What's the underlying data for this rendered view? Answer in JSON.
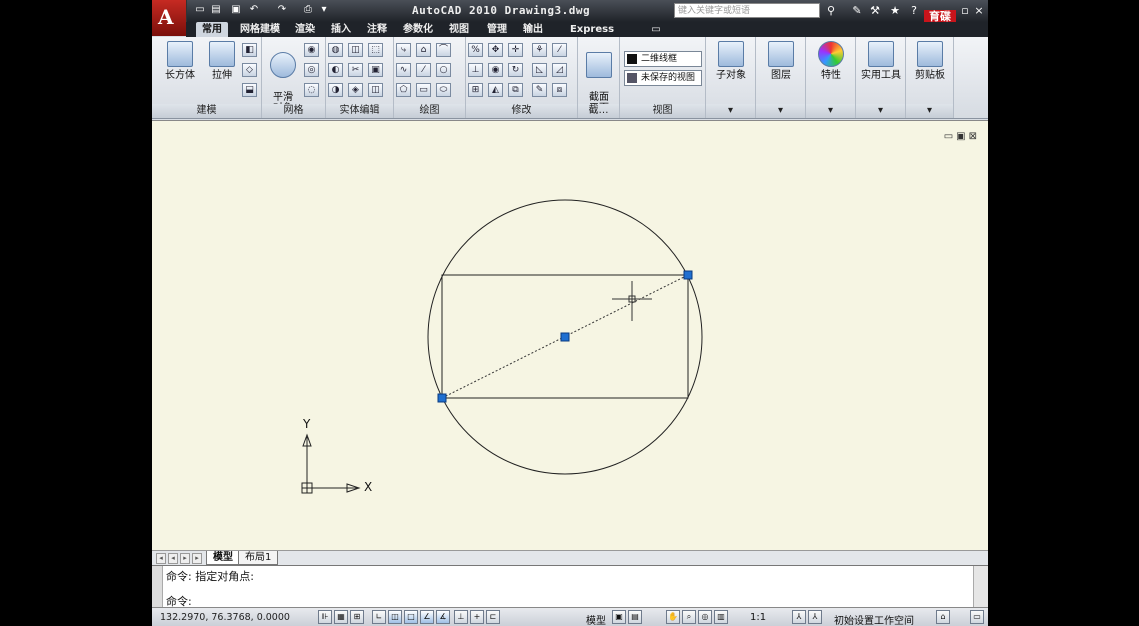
{
  "window": {
    "title": "AutoCAD 2010  Drawing3.dwg",
    "search_placeholder": "键入关键字或短语",
    "logo_text": "育碟教育"
  },
  "tabs": [
    "常用",
    "网格建模",
    "渲染",
    "插入",
    "注释",
    "参数化",
    "视图",
    "管理",
    "输出",
    "Express Tools"
  ],
  "ribbon": {
    "modeling": {
      "box": "长方体",
      "extrude": "拉伸",
      "label": "建模"
    },
    "mesh": {
      "smooth": "平滑\n对象",
      "label": "网格"
    },
    "solid_edit": {
      "label": "实体编辑"
    },
    "draw": {
      "label": "绘图"
    },
    "modify": {
      "label": "修改"
    },
    "section": {
      "plane": "截面\n平面",
      "label": "截…"
    },
    "view": {
      "visual_style": "二维线框",
      "saved_view": "未保存的视图",
      "label": "视图"
    },
    "subobject": "子对象",
    "layers": "图层",
    "properties": "特性",
    "utilities": "实用工具",
    "clipboard": "剪贴板"
  },
  "canvas": {
    "axis_x": "X",
    "axis_y": "Y"
  },
  "layout_tabs": [
    "模型",
    "布局1"
  ],
  "command": {
    "history": "命令: 指定对角点:",
    "prompt": "命令:"
  },
  "status": {
    "coords": "132.2970, 76.3768, 0.0000",
    "model": "模型",
    "scale": "1:1",
    "workspace": "初始设置工作空间"
  },
  "colors": {
    "canvas_bg": "#f6f5e3",
    "grip": "#1f6fd0",
    "app_red": "#c62a22"
  }
}
